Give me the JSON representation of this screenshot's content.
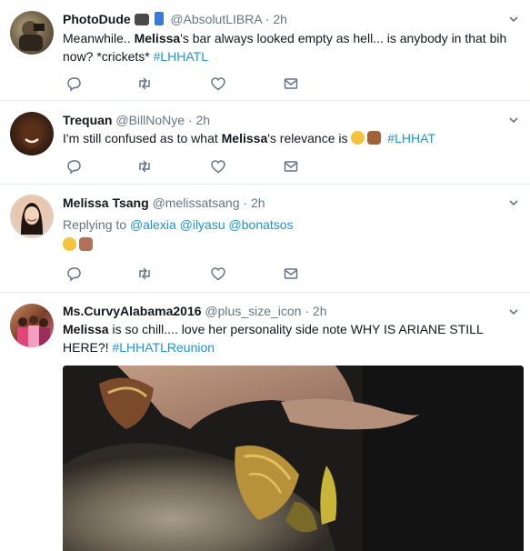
{
  "tweets": [
    {
      "name": "PhotoDude",
      "handle": "@AbsolutLIBRA",
      "dot": "·",
      "time": "2h",
      "text_pre": "Meanwhile.. ",
      "bold": "Melissa",
      "text_post": "'s bar always looked empty as hell... is anybody in that bih now? *crickets* ",
      "hashtag": "#LHHATL"
    },
    {
      "name": "Trequan",
      "handle": "@BillNoNye",
      "dot": "·",
      "time": "2h",
      "text_pre": "I'm still confused as to what ",
      "bold": "Melissa",
      "text_post": "'s relevance is",
      "hashtag": "#LHHAT"
    },
    {
      "name": "Melissa Tsang",
      "handle": "@melissatsang",
      "dot": "·",
      "time": "2h",
      "replying_label": "Replying to",
      "mentions": [
        "@alexia",
        "@ilyasu",
        "@bonatsos"
      ]
    },
    {
      "name": "Ms.CurvyAlabama2016",
      "handle": "@plus_size_icon",
      "dot": "·",
      "time": "2h",
      "bold": "Melissa",
      "text_post": " is so chill.... love her personality side note WHY IS ARIANE STILL HERE?! ",
      "hashtag": "#LHHATLReunion"
    }
  ],
  "icons": {
    "reply": "reply-icon",
    "retweet": "retweet-icon",
    "like": "heart-icon",
    "message": "direct-message-icon",
    "more": "chevron-down-icon"
  },
  "colors": {
    "link": "#1b95e0",
    "secondary": "#657786",
    "icon": "#657786",
    "divider": "#e6ecf0"
  }
}
